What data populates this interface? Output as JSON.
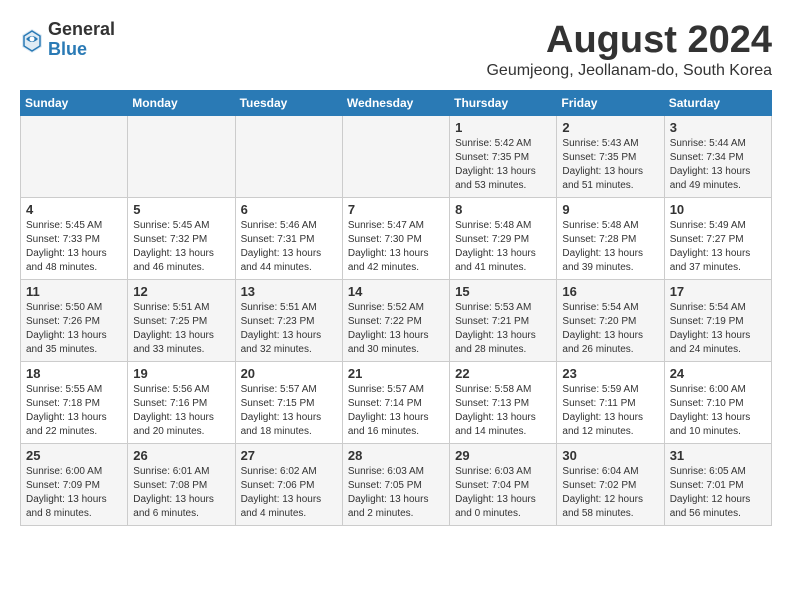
{
  "header": {
    "logo_general": "General",
    "logo_blue": "Blue",
    "month_title": "August 2024",
    "subtitle": "Geumjeong, Jeollanam-do, South Korea"
  },
  "weekdays": [
    "Sunday",
    "Monday",
    "Tuesday",
    "Wednesday",
    "Thursday",
    "Friday",
    "Saturday"
  ],
  "weeks": [
    [
      {
        "day": "",
        "info": ""
      },
      {
        "day": "",
        "info": ""
      },
      {
        "day": "",
        "info": ""
      },
      {
        "day": "",
        "info": ""
      },
      {
        "day": "1",
        "info": "Sunrise: 5:42 AM\nSunset: 7:35 PM\nDaylight: 13 hours\nand 53 minutes."
      },
      {
        "day": "2",
        "info": "Sunrise: 5:43 AM\nSunset: 7:35 PM\nDaylight: 13 hours\nand 51 minutes."
      },
      {
        "day": "3",
        "info": "Sunrise: 5:44 AM\nSunset: 7:34 PM\nDaylight: 13 hours\nand 49 minutes."
      }
    ],
    [
      {
        "day": "4",
        "info": "Sunrise: 5:45 AM\nSunset: 7:33 PM\nDaylight: 13 hours\nand 48 minutes."
      },
      {
        "day": "5",
        "info": "Sunrise: 5:45 AM\nSunset: 7:32 PM\nDaylight: 13 hours\nand 46 minutes."
      },
      {
        "day": "6",
        "info": "Sunrise: 5:46 AM\nSunset: 7:31 PM\nDaylight: 13 hours\nand 44 minutes."
      },
      {
        "day": "7",
        "info": "Sunrise: 5:47 AM\nSunset: 7:30 PM\nDaylight: 13 hours\nand 42 minutes."
      },
      {
        "day": "8",
        "info": "Sunrise: 5:48 AM\nSunset: 7:29 PM\nDaylight: 13 hours\nand 41 minutes."
      },
      {
        "day": "9",
        "info": "Sunrise: 5:48 AM\nSunset: 7:28 PM\nDaylight: 13 hours\nand 39 minutes."
      },
      {
        "day": "10",
        "info": "Sunrise: 5:49 AM\nSunset: 7:27 PM\nDaylight: 13 hours\nand 37 minutes."
      }
    ],
    [
      {
        "day": "11",
        "info": "Sunrise: 5:50 AM\nSunset: 7:26 PM\nDaylight: 13 hours\nand 35 minutes."
      },
      {
        "day": "12",
        "info": "Sunrise: 5:51 AM\nSunset: 7:25 PM\nDaylight: 13 hours\nand 33 minutes."
      },
      {
        "day": "13",
        "info": "Sunrise: 5:51 AM\nSunset: 7:23 PM\nDaylight: 13 hours\nand 32 minutes."
      },
      {
        "day": "14",
        "info": "Sunrise: 5:52 AM\nSunset: 7:22 PM\nDaylight: 13 hours\nand 30 minutes."
      },
      {
        "day": "15",
        "info": "Sunrise: 5:53 AM\nSunset: 7:21 PM\nDaylight: 13 hours\nand 28 minutes."
      },
      {
        "day": "16",
        "info": "Sunrise: 5:54 AM\nSunset: 7:20 PM\nDaylight: 13 hours\nand 26 minutes."
      },
      {
        "day": "17",
        "info": "Sunrise: 5:54 AM\nSunset: 7:19 PM\nDaylight: 13 hours\nand 24 minutes."
      }
    ],
    [
      {
        "day": "18",
        "info": "Sunrise: 5:55 AM\nSunset: 7:18 PM\nDaylight: 13 hours\nand 22 minutes."
      },
      {
        "day": "19",
        "info": "Sunrise: 5:56 AM\nSunset: 7:16 PM\nDaylight: 13 hours\nand 20 minutes."
      },
      {
        "day": "20",
        "info": "Sunrise: 5:57 AM\nSunset: 7:15 PM\nDaylight: 13 hours\nand 18 minutes."
      },
      {
        "day": "21",
        "info": "Sunrise: 5:57 AM\nSunset: 7:14 PM\nDaylight: 13 hours\nand 16 minutes."
      },
      {
        "day": "22",
        "info": "Sunrise: 5:58 AM\nSunset: 7:13 PM\nDaylight: 13 hours\nand 14 minutes."
      },
      {
        "day": "23",
        "info": "Sunrise: 5:59 AM\nSunset: 7:11 PM\nDaylight: 13 hours\nand 12 minutes."
      },
      {
        "day": "24",
        "info": "Sunrise: 6:00 AM\nSunset: 7:10 PM\nDaylight: 13 hours\nand 10 minutes."
      }
    ],
    [
      {
        "day": "25",
        "info": "Sunrise: 6:00 AM\nSunset: 7:09 PM\nDaylight: 13 hours\nand 8 minutes."
      },
      {
        "day": "26",
        "info": "Sunrise: 6:01 AM\nSunset: 7:08 PM\nDaylight: 13 hours\nand 6 minutes."
      },
      {
        "day": "27",
        "info": "Sunrise: 6:02 AM\nSunset: 7:06 PM\nDaylight: 13 hours\nand 4 minutes."
      },
      {
        "day": "28",
        "info": "Sunrise: 6:03 AM\nSunset: 7:05 PM\nDaylight: 13 hours\nand 2 minutes."
      },
      {
        "day": "29",
        "info": "Sunrise: 6:03 AM\nSunset: 7:04 PM\nDaylight: 13 hours\nand 0 minutes."
      },
      {
        "day": "30",
        "info": "Sunrise: 6:04 AM\nSunset: 7:02 PM\nDaylight: 12 hours\nand 58 minutes."
      },
      {
        "day": "31",
        "info": "Sunrise: 6:05 AM\nSunset: 7:01 PM\nDaylight: 12 hours\nand 56 minutes."
      }
    ]
  ]
}
